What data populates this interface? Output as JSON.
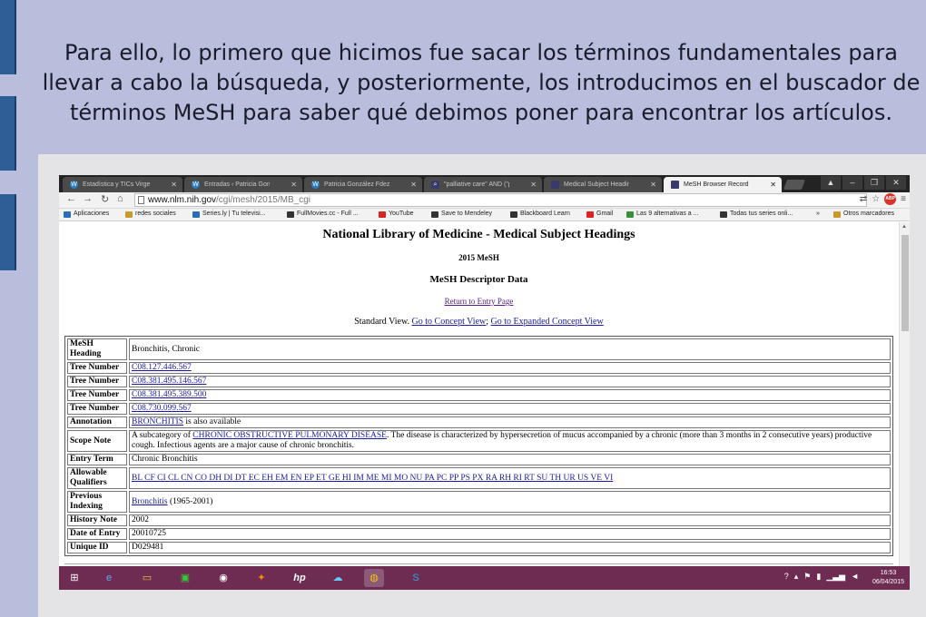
{
  "slide": {
    "caption": "Para ello, lo primero que hicimos fue sacar los términos fundamentales para llevar a cabo la búsqueda, y posteriormente, los introducimos en el buscador de términos MeSH para saber qué debimos poner para encontrar los artículos."
  },
  "browser": {
    "tabs": [
      {
        "label": "Estadística y TICs Virgen...",
        "icon": "wordpress-icon"
      },
      {
        "label": "Entradas ‹ Patricia González...",
        "icon": "wordpress-icon"
      },
      {
        "label": "Patricia González Fdez",
        "icon": "wordpress-icon"
      },
      {
        "label": "\"palliative care\" AND (\"pa...",
        "icon": "search-icon"
      },
      {
        "label": "Medical Subject Headings...",
        "icon": "nlm-icon"
      },
      {
        "label": "MeSH Browser Record",
        "icon": "nlm-icon"
      }
    ],
    "url_host": "www.nlm.nih.gov",
    "url_path": "/cgi/mesh/2015/MB_cgi",
    "abp_label": "ABP",
    "bookmarks": [
      "Aplicaciones",
      "redes sociales",
      "Series.ly | Tu televisi...",
      "FullMovies.cc - Full ...",
      "YouTube",
      "Save to Mendeley",
      "Blackboard Learn",
      "Gmail",
      "Las 9 alternativas a ...",
      "Todas tus series onli...",
      "»",
      "Otros marcadores"
    ]
  },
  "page": {
    "title": "National Library of Medicine - Medical Subject Headings",
    "year": "2015 MeSH",
    "section": "MeSH Descriptor Data",
    "return_link": "Return to Entry Page",
    "standard_view_label": "Standard View.",
    "concept_view_link": "Go to Concept View",
    "separator": ";",
    "expanded_view_link": "Go to Expanded Concept View",
    "rows": {
      "heading_label": "MeSH Heading",
      "heading_value": "Bronchitis, Chronic",
      "tree_label": "Tree Number",
      "tree_numbers": [
        "C08.127.446.567",
        "C08.381.495.146.567",
        "C08.381.495.389.500",
        "C08.730.099.567"
      ],
      "annotation_label": "Annotation",
      "annotation_link": "BRONCHITIS",
      "annotation_text": " is also available",
      "scope_label": "Scope Note",
      "scope_pre": "A subcategory of ",
      "scope_link": "CHRONIC OBSTRUCTIVE PULMONARY DISEASE",
      "scope_post": ". The disease is characterized by hypersecretion of mucus accompanied by a chronic (more than 3 months in 2 consecutive years) productive cough. Infectious agents are a major cause of chronic bronchitis.",
      "entry_label": "Entry Term",
      "entry_value": "Chronic Bronchitis",
      "qualifiers_label": "Allowable Qualifiers",
      "qualifiers": "BL CF CI CL CN CO DH DI DT EC EH EM EN EP ET GE HI IM ME MI MO NU PA PC PP PS PX RA RH RI RT SU TH UR US VE VI",
      "prev_label": "Previous Indexing",
      "prev_link": "Bronchitis",
      "prev_text": " (1965-2001)",
      "history_label": "History Note",
      "history_value": "2002",
      "date_label": "Date of Entry",
      "date_value": "20010725",
      "uid_label": "Unique ID",
      "uid_value": "D029481"
    }
  },
  "taskbar": {
    "time": "16:53",
    "date": "06/04/2015",
    "hp_label": "hp"
  }
}
